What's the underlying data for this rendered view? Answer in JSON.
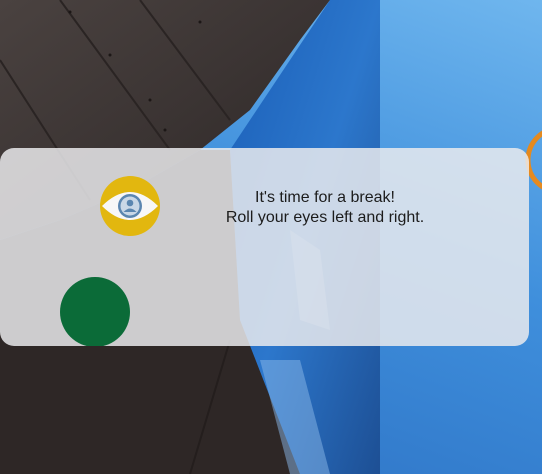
{
  "break_prompt": {
    "line1": "It's time for a break!",
    "line2": "Roll your eyes left and right.",
    "icon": "eye-icon",
    "accent_color": "#e2b70f",
    "timer_color": "#0b6b38"
  },
  "wallpaper": {
    "sky_color": "#3f8fdc",
    "building_color": "#3a3433"
  }
}
